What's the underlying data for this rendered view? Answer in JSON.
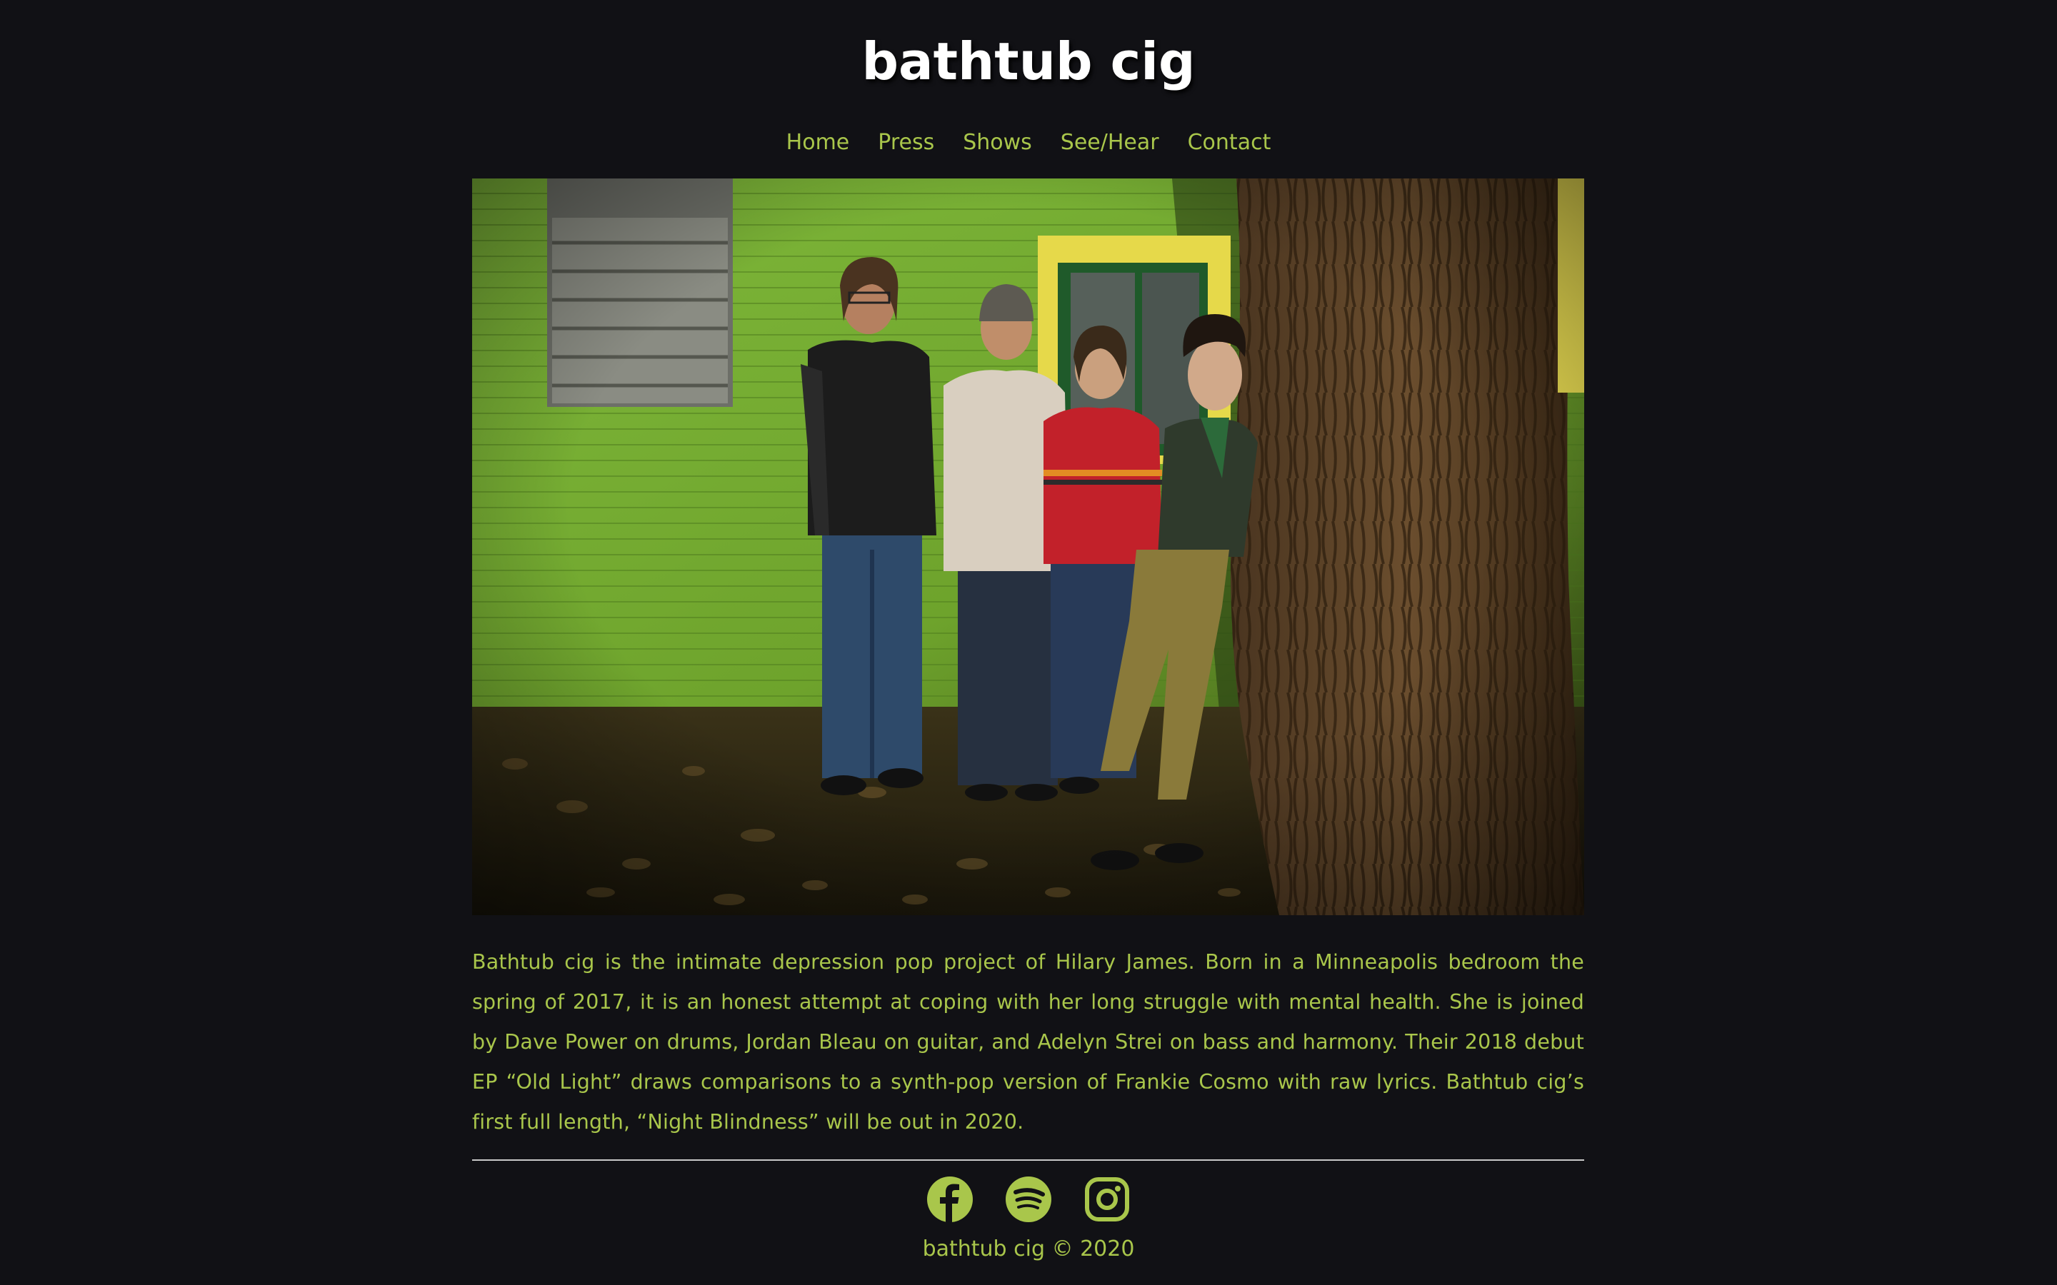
{
  "site": {
    "title": "bathtub cig"
  },
  "nav": {
    "items": [
      {
        "label": "Home"
      },
      {
        "label": "Press"
      },
      {
        "label": "Shows"
      },
      {
        "label": "See/Hear"
      },
      {
        "label": "Contact"
      }
    ]
  },
  "hero": {
    "alt": "Band photo of four members standing in front of a green house beside a large tree"
  },
  "bio": {
    "text": "Bathtub cig is the intimate depression pop project of Hilary James.  Born in a Minneapolis bedroom the spring of 2017, it is an honest attempt at coping with her long struggle with mental health.  She is joined by Dave Power on drums, Jordan Bleau on guitar, and Adelyn Strei on bass and harmony. Their 2018 debut EP “Old Light” draws comparisons to a synth-pop version of Frankie Cosmo with raw lyrics.  Bathtub cig’s first full length, “Night Blindness” will be out in 2020."
  },
  "social": {
    "icons": [
      {
        "name": "facebook-icon"
      },
      {
        "name": "spotify-icon"
      },
      {
        "name": "instagram-icon"
      }
    ]
  },
  "footer": {
    "copyright": "bathtub cig © 2020"
  },
  "colors": {
    "background": "#111115",
    "accent": "#a9c64b",
    "title": "#ffffff",
    "divider": "#c9c9c9"
  }
}
